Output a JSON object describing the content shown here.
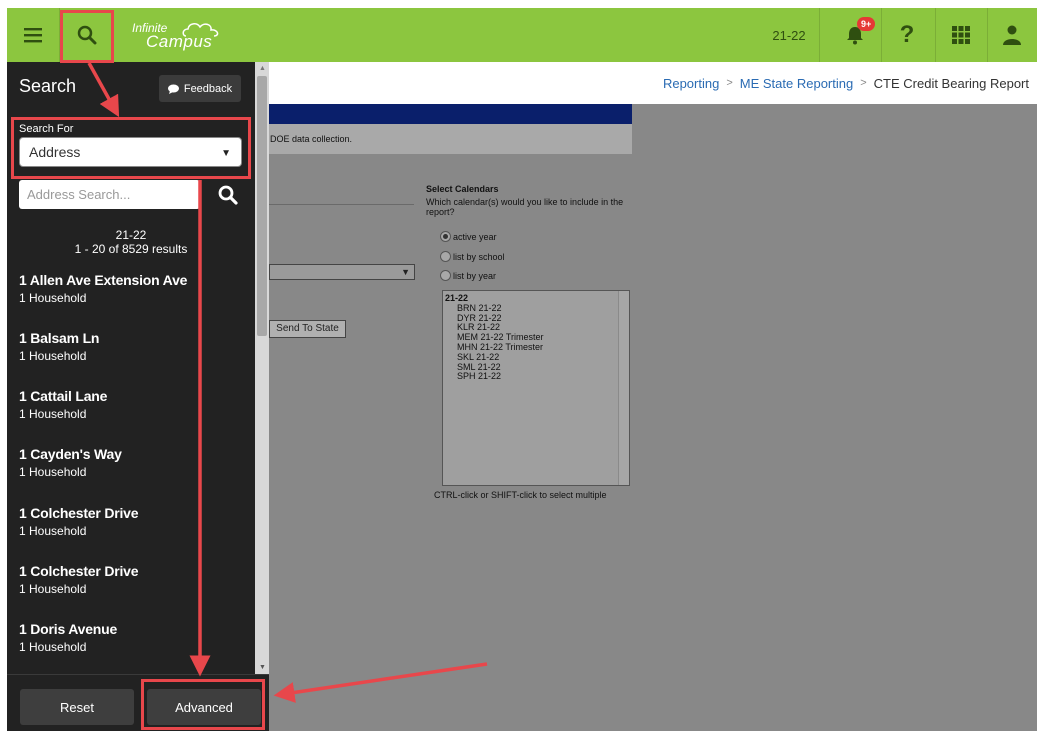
{
  "topbar": {
    "logo_line1": "Infinite",
    "logo_line2": "Campus",
    "year": "21-22",
    "notification_count": "9+"
  },
  "breadcrumb": {
    "items": [
      "Reporting",
      "ME State Reporting"
    ],
    "current": "CTE Credit Bearing Report"
  },
  "report": {
    "description": "DOE data collection.",
    "send_button": "Send To State",
    "calendars_title": "Select Calendars",
    "calendars_question": "Which calendar(s) would you like to include in the report?",
    "radio_options": [
      "active year",
      "list by school",
      "list by year"
    ],
    "selected_radio": "active year",
    "calendar_group": "21-22",
    "calendar_options": [
      "BRN 21-22",
      "DYR 21-22",
      "KLR 21-22",
      "MEM 21-22 Trimester",
      "MHN 21-22 Trimester",
      "SKL 21-22",
      "SML 21-22",
      "SPH 21-22"
    ],
    "calendar_hint": "CTRL-click or SHIFT-click to select multiple"
  },
  "search_panel": {
    "title": "Search",
    "feedback_label": "Feedback",
    "search_for_label": "Search For",
    "search_type": "Address",
    "search_placeholder": "Address Search...",
    "result_year": "21-22",
    "result_count": "1 - 20 of 8529 results",
    "results": [
      {
        "name": "1 Allen Ave Extension Ave",
        "sub": "1 Household"
      },
      {
        "name": "1 Balsam Ln",
        "sub": "1 Household"
      },
      {
        "name": "1 Cattail Lane",
        "sub": "1 Household"
      },
      {
        "name": "1 Cayden's Way",
        "sub": "1 Household"
      },
      {
        "name": "1 Colchester Drive",
        "sub": "1 Household"
      },
      {
        "name": "1 Colchester Drive",
        "sub": "1 Household"
      },
      {
        "name": "1 Doris Avenue",
        "sub": "1 Household"
      }
    ],
    "reset_label": "Reset",
    "advanced_label": "Advanced"
  },
  "colors": {
    "topbar": "#8cc63f",
    "panel": "#222222",
    "annotation": "#e8474b",
    "link": "#2a6bb3"
  },
  "icons": [
    "menu-icon",
    "search-icon",
    "bell-icon",
    "help-icon",
    "apps-grid-icon",
    "user-icon",
    "chat-icon",
    "caret-down-icon"
  ]
}
